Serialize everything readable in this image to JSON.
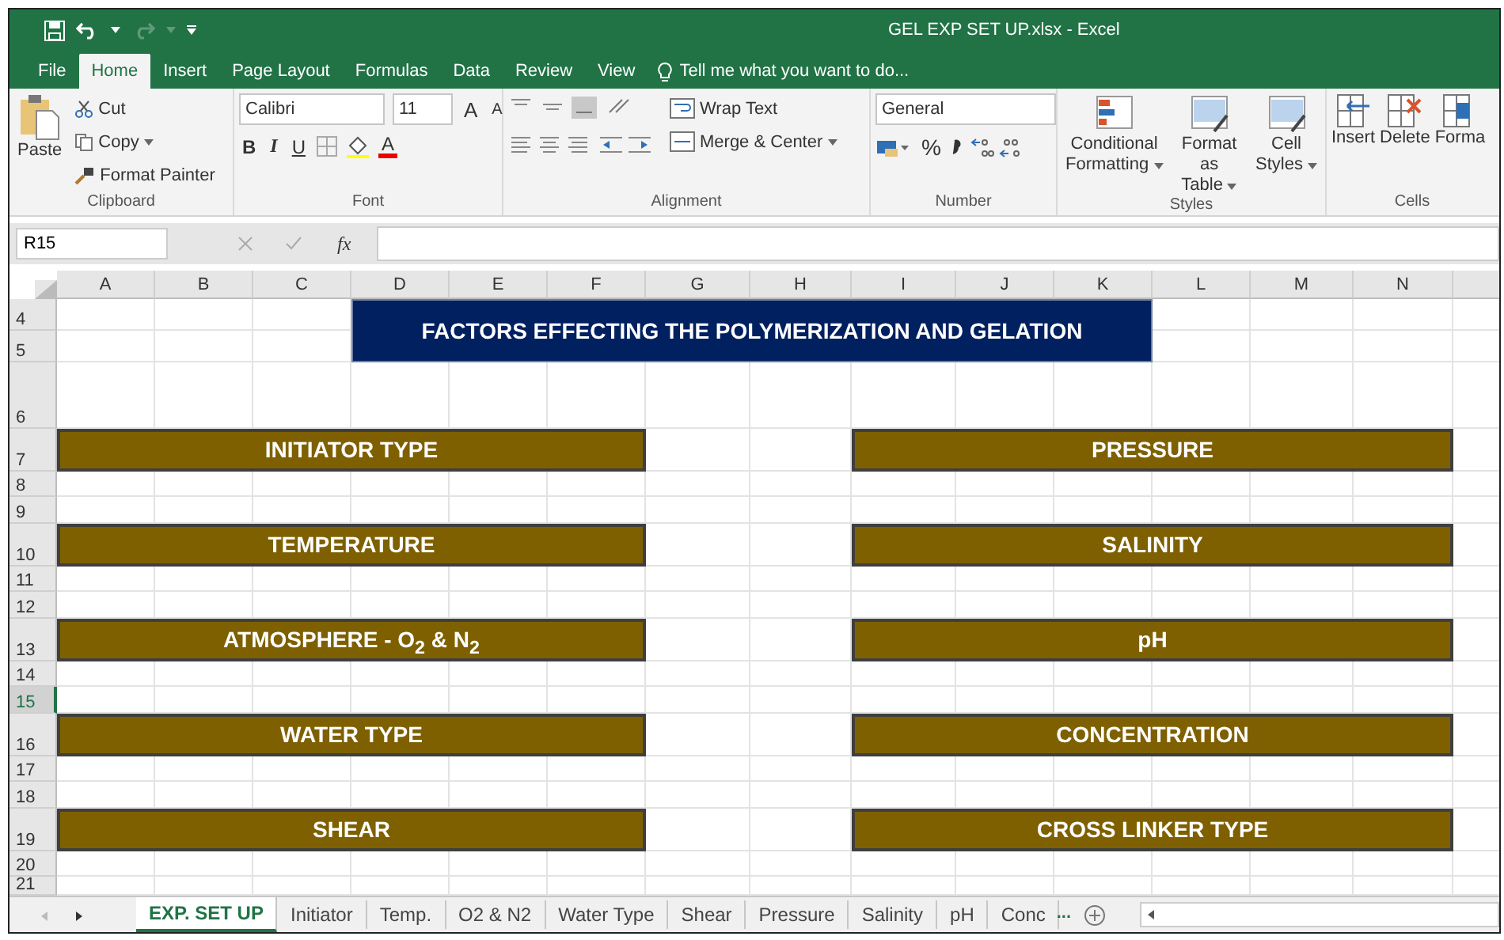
{
  "window": {
    "title": "GEL EXP SET UP.xlsx - Excel"
  },
  "ribbon_tabs": [
    {
      "label": "File",
      "selected": false
    },
    {
      "label": "Home",
      "selected": true
    },
    {
      "label": "Insert",
      "selected": false
    },
    {
      "label": "Page Layout",
      "selected": false
    },
    {
      "label": "Formulas",
      "selected": false
    },
    {
      "label": "Data",
      "selected": false
    },
    {
      "label": "Review",
      "selected": false
    },
    {
      "label": "View",
      "selected": false
    }
  ],
  "tell_me": {
    "placeholder": "Tell me what you want to do..."
  },
  "clipboard": {
    "label": "Clipboard",
    "paste": "Paste",
    "cut": "Cut",
    "copy": "Copy",
    "format_painter": "Format Painter"
  },
  "font": {
    "label": "Font",
    "name": "Calibri",
    "size": "11",
    "grow": "A",
    "shrink": "A",
    "bold": "B",
    "italic": "I",
    "underline": "U",
    "font_color": "A"
  },
  "alignment": {
    "label": "Alignment",
    "wrap_text": "Wrap Text",
    "merge": "Merge & Center"
  },
  "number": {
    "label": "Number",
    "format": "General",
    "percent": "%"
  },
  "styles": {
    "label": "Styles",
    "items": [
      {
        "line1": "Conditional",
        "line2": "Formatting"
      },
      {
        "line1": "Format as",
        "line2": "Table"
      },
      {
        "line1": "Cell",
        "line2": "Styles"
      }
    ]
  },
  "cells": {
    "label": "Cells",
    "items": [
      "Insert",
      "Delete",
      "Forma"
    ]
  },
  "formula_bar": {
    "name_box": "R15",
    "function_label": "fx"
  },
  "sheet": {
    "columns": [
      {
        "label": "A"
      },
      {
        "label": "B"
      },
      {
        "label": "C"
      },
      {
        "label": "D"
      },
      {
        "label": "E"
      },
      {
        "label": "F"
      },
      {
        "label": "G"
      },
      {
        "label": "H"
      },
      {
        "label": "I"
      },
      {
        "label": "J"
      },
      {
        "label": "K"
      },
      {
        "label": "L"
      },
      {
        "label": "M"
      },
      {
        "label": "N"
      }
    ],
    "rows": [
      {
        "label": "4",
        "selected": false
      },
      {
        "label": "5",
        "selected": false
      },
      {
        "label": "6",
        "selected": false
      },
      {
        "label": "7",
        "selected": false
      },
      {
        "label": "8",
        "selected": false
      },
      {
        "label": "9",
        "selected": false
      },
      {
        "label": "10",
        "selected": false
      },
      {
        "label": "11",
        "selected": false
      },
      {
        "label": "12",
        "selected": false
      },
      {
        "label": "13",
        "selected": false
      },
      {
        "label": "14",
        "selected": false
      },
      {
        "label": "15",
        "selected": true
      },
      {
        "label": "16",
        "selected": false
      },
      {
        "label": "17",
        "selected": false
      },
      {
        "label": "18",
        "selected": false
      },
      {
        "label": "19",
        "selected": false
      },
      {
        "label": "20",
        "selected": false
      },
      {
        "label": "21",
        "selected": false
      }
    ],
    "title": "FACTORS EFFECTING THE POLYMERIZATION AND GELATION",
    "factors_left": [
      "INITIATOR TYPE",
      "TEMPERATURE",
      "ATMOSPHERE - O$_{2}$ & N$_{2}$",
      "WATER TYPE",
      "SHEAR"
    ],
    "factors_right": [
      "PRESSURE",
      "SALINITY",
      "pH",
      "CONCENTRATION",
      "CROSS LINKER TYPE"
    ]
  },
  "sheet_tabs": [
    {
      "label": "EXP. SET UP",
      "selected": true
    },
    {
      "label": "Initiator",
      "selected": false
    },
    {
      "label": "Temp.",
      "selected": false
    },
    {
      "label": "O2 & N2",
      "selected": false
    },
    {
      "label": "Water Type",
      "selected": false
    },
    {
      "label": "Shear",
      "selected": false
    },
    {
      "label": "Pressure",
      "selected": false
    },
    {
      "label": "Salinity",
      "selected": false
    },
    {
      "label": "pH",
      "selected": false
    },
    {
      "label": "Conc",
      "selected": false
    }
  ],
  "more_tabs": "..."
}
